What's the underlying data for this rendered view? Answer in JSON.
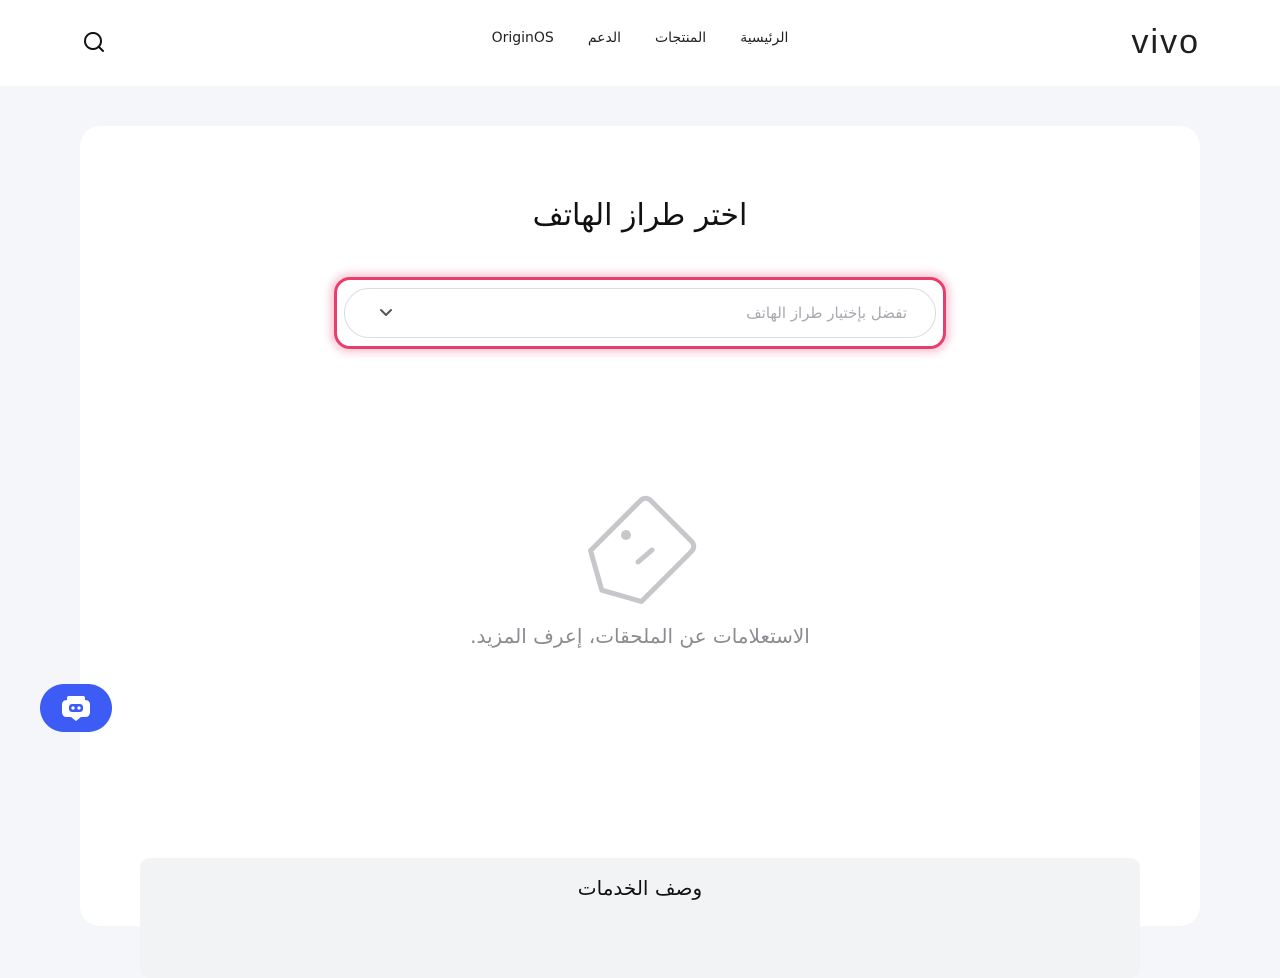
{
  "header": {
    "logo_text": "vivo",
    "nav": [
      {
        "label": "الرئيسية"
      },
      {
        "label": "المنتجات"
      },
      {
        "label": "الدعم"
      },
      {
        "label": "OriginOS"
      }
    ]
  },
  "main": {
    "title": "اختر طراز الهاتف",
    "select": {
      "placeholder": "تفضل بإختيار طراز الهاتف"
    },
    "empty_state": {
      "message": "الاستعلامات عن الملحقات، إعرف المزيد."
    },
    "services": {
      "title": "وصف الخدمات"
    }
  },
  "colors": {
    "accent": "#3d5cf5",
    "focus_ring": "#e83e6d",
    "page_bg": "#f5f6f9"
  },
  "icons": {
    "search": "search-icon",
    "dropdown": "chevron-down-icon",
    "empty": "tag-face-icon",
    "chat": "chatbot-icon"
  }
}
